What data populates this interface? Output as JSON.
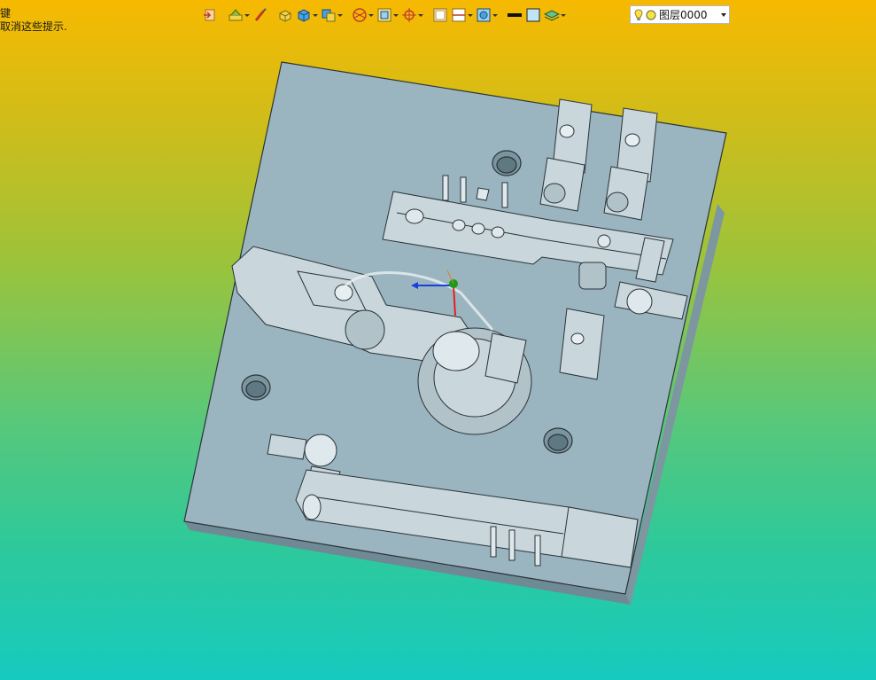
{
  "hint": {
    "line1": "键",
    "line2": "取消这些提示."
  },
  "toolbar": {
    "items": [
      {
        "icon": "exit-sketch-icon",
        "dropdown": false
      },
      {
        "icon": "layer-manager-icon",
        "dropdown": true
      },
      {
        "icon": "brush-icon",
        "dropdown": false
      },
      {
        "icon": "box-solid-icon",
        "dropdown": false
      },
      {
        "icon": "shaded-cube-icon",
        "dropdown": true
      },
      {
        "icon": "display-mode-icon",
        "dropdown": true
      },
      {
        "icon": "section-view-icon",
        "dropdown": true
      },
      {
        "icon": "view-orientation-icon",
        "dropdown": true
      },
      {
        "icon": "origin-target-icon",
        "dropdown": true
      },
      {
        "icon": "window-frame-icon",
        "dropdown": false
      },
      {
        "icon": "split-view-icon",
        "dropdown": true
      },
      {
        "icon": "render-settings-icon",
        "dropdown": true
      },
      {
        "icon": "line-color-icon",
        "dropdown": false
      },
      {
        "icon": "fill-color-icon",
        "dropdown": false
      },
      {
        "icon": "layer-stack-icon",
        "dropdown": true
      }
    ],
    "layer": {
      "name": "图层0000",
      "colors": {
        "bulb": "#ffe04a",
        "circle": "#f2e54a"
      }
    }
  },
  "colors": {
    "plate": "#9ab5bf",
    "plate_edge": "#6f8a94",
    "parts": "#c9d6dc",
    "lines": "#2a3338",
    "axis_x": "#e02020",
    "axis_y": "#1a9a1a",
    "axis_z": "#1a3ee0"
  }
}
